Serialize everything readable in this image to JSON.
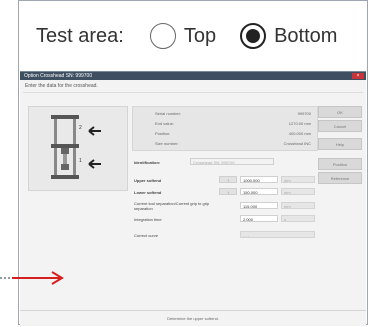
{
  "test_area": {
    "label": "Test area:",
    "options": [
      "Top",
      "Bottom"
    ],
    "selected": "Bottom"
  },
  "dialog": {
    "title": "Option Crosshead SN: 999700",
    "close": "×",
    "subtitle": "Enter the data for the crosshead.",
    "info": [
      {
        "key": "Serial number:",
        "value": "999700"
      },
      {
        "key": "End value:",
        "value": "1270.00 mm"
      },
      {
        "key": "Position:",
        "value": "400.000 mm"
      },
      {
        "key": "Size number:",
        "value": "Crosshead INC"
      }
    ],
    "side_buttons": [
      "OK",
      "Cancel",
      "Help",
      "Position",
      "Reference"
    ],
    "form": {
      "identification_label": "Identification:",
      "identification_value": "Crosshead SN: 999700",
      "upper_label": "Upper softend",
      "upper_value": "1000.000",
      "upper_unit": "mm",
      "lower_label": "Lower softend",
      "lower_value": "150.000",
      "lower_unit": "mm",
      "separation_label": "Current tool separation/Current grip to grip separation",
      "separation_value": "115.000",
      "separation_unit": "mm",
      "integration_label": "Integration time",
      "integration_value": "2.000",
      "integration_unit": "s",
      "correct_curve_label": "Correct curve",
      "correct_curve_value": "- - -",
      "set_button": "↑"
    },
    "status": "Determine the upper softend."
  }
}
